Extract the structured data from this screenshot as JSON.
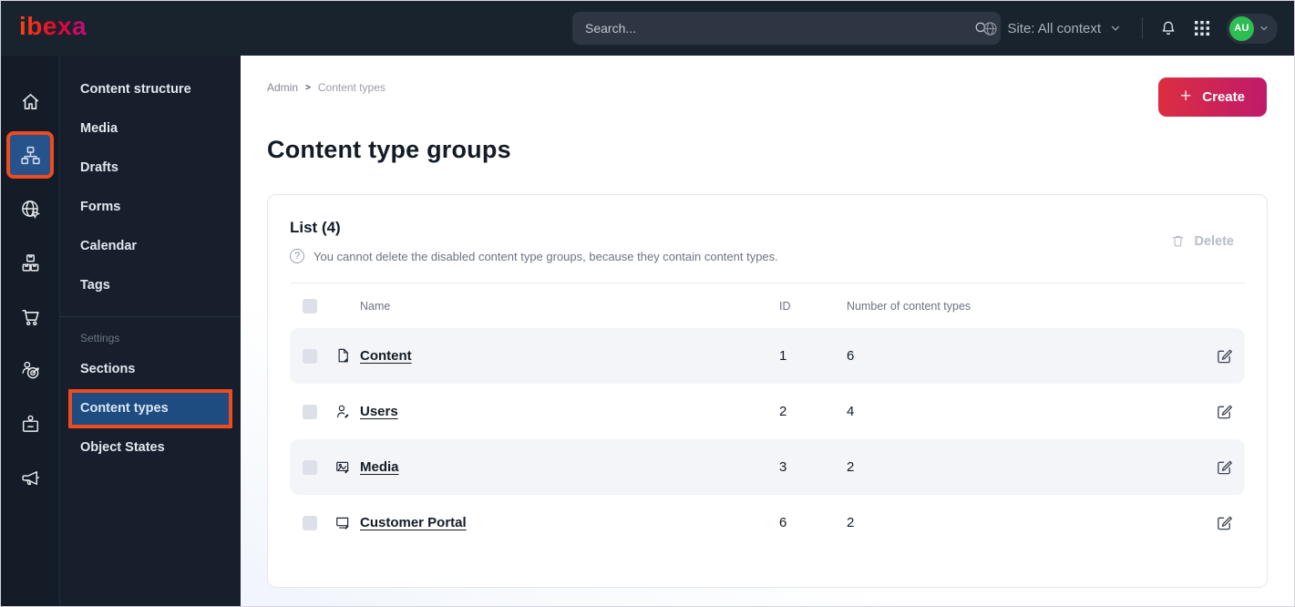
{
  "brand": {
    "logo_text": "ibexa"
  },
  "topbar": {
    "search_placeholder": "Search...",
    "site_context_label": "Site: All context",
    "avatar_initials": "AU"
  },
  "sidebar": {
    "items": [
      "Content structure",
      "Media",
      "Drafts",
      "Forms",
      "Calendar",
      "Tags"
    ],
    "section_label": "Settings",
    "settings_items": [
      "Sections",
      "Content types",
      "Object States"
    ],
    "active_item": "Content types"
  },
  "breadcrumb": {
    "root": "Admin",
    "current": "Content types"
  },
  "page": {
    "title": "Content type groups"
  },
  "actions": {
    "create_label": "Create",
    "delete_label": "Delete"
  },
  "list": {
    "title": "List (4)",
    "info_text": "You cannot delete the disabled content type groups, because they contain content types.",
    "columns": {
      "name": "Name",
      "id": "ID",
      "count": "Number of content types"
    },
    "rows": [
      {
        "name": "Content",
        "icon": "file-icon",
        "id": "1",
        "count": "6"
      },
      {
        "name": "Users",
        "icon": "user-icon",
        "id": "2",
        "count": "4"
      },
      {
        "name": "Media",
        "icon": "image-icon",
        "id": "3",
        "count": "2"
      },
      {
        "name": "Customer Portal",
        "icon": "monitor-icon",
        "id": "6",
        "count": "2"
      }
    ]
  },
  "colors": {
    "topbar_bg": "#19232e",
    "sidebar_bg": "#161f2b",
    "active_blue": "#1e4c80",
    "highlight_orange": "#ee4b1e",
    "create_gradient_start": "#dc2e40",
    "create_gradient_end": "#bf1a6b",
    "avatar_green": "#2dbd52",
    "row_alt_bg": "#f4f5f8",
    "text_dark": "#131c26"
  }
}
